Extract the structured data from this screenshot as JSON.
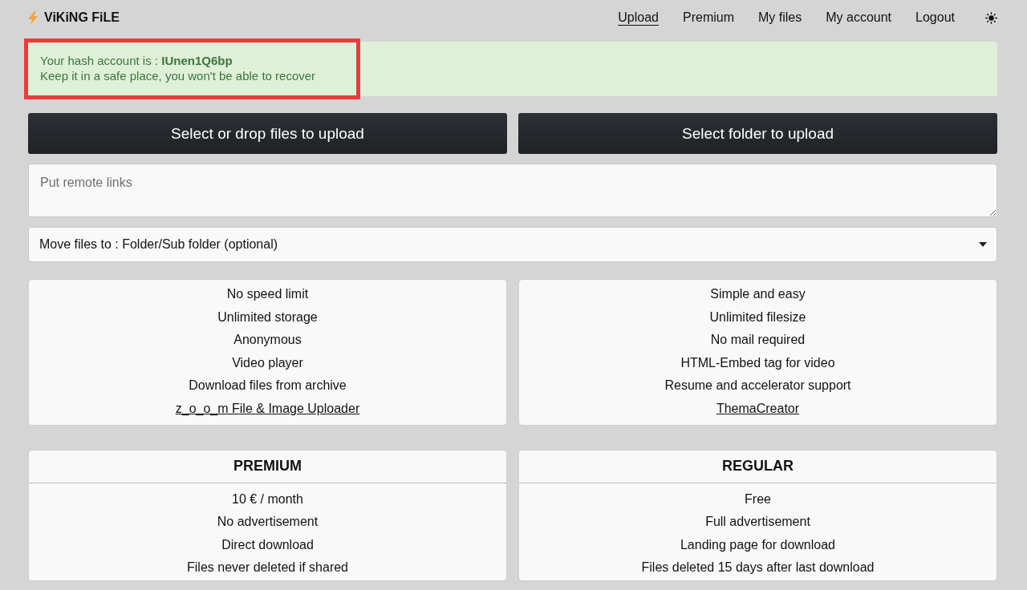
{
  "header": {
    "logo": "ViKiNG FiLE",
    "nav": [
      {
        "label": "Upload",
        "selected": true
      },
      {
        "label": "Premium",
        "selected": false
      },
      {
        "label": "My files",
        "selected": false
      },
      {
        "label": "My account",
        "selected": false
      },
      {
        "label": "Logout",
        "selected": false
      }
    ]
  },
  "alert": {
    "line_1": "Your hash account is : **IUnen1Q6bp**",
    "line_2": "Keep it in a safe place, you won't be able to recover",
    "highlighted": true
  },
  "upload_buttons": [
    "Select or drop files to upload",
    "Select folder to upload"
  ],
  "remote_links": {
    "placeholder": "Put remote links"
  },
  "folder_select": {
    "value": "Move files to : Folder/Sub folder (optional)"
  },
  "features": [
    {
      "items": [
        {
          "kind": "text",
          "text": "No speed limit"
        },
        {
          "kind": "text",
          "text": "Unlimited storage"
        },
        {
          "kind": "text",
          "text": "Anonymous"
        },
        {
          "kind": "text",
          "text": "Video player"
        },
        {
          "kind": "text",
          "text": "Download files from archive"
        },
        {
          "kind": "link",
          "text": "z_o_o_m File & Image Uploader"
        }
      ]
    },
    {
      "items": [
        {
          "kind": "text",
          "text": "Simple and easy"
        },
        {
          "kind": "text",
          "text": "Unlimited filesize"
        },
        {
          "kind": "text",
          "text": "No mail required"
        },
        {
          "kind": "text",
          "text": "HTML-Embed tag for video"
        },
        {
          "kind": "text",
          "text": "Resume and accelerator support"
        },
        {
          "kind": "link",
          "text": "ThemaCreator"
        }
      ]
    }
  ],
  "plans": [
    {
      "title": "PREMIUM",
      "items": [
        "10 € / month",
        "No advertisement",
        "Direct download",
        "Files never deleted if shared"
      ]
    },
    {
      "title": "REGULAR",
      "items": [
        "Free",
        "Full advertisement",
        "Landing page for download",
        "Files deleted 15 days after last download"
      ]
    }
  ]
}
